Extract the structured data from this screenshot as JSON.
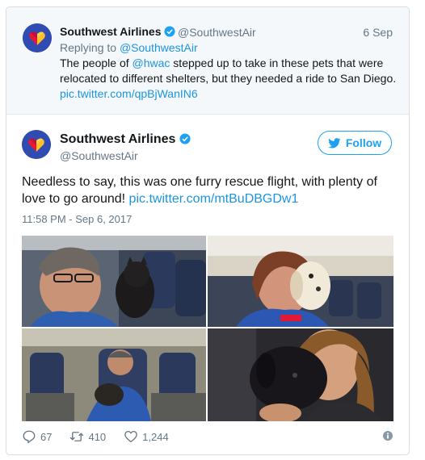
{
  "parent_tweet": {
    "name": "Southwest Airlines",
    "handle": "@SouthwestAir",
    "date": "6 Sep",
    "replying_prefix": "Replying to ",
    "replying_to": "@SouthwestAir",
    "text_1": "The people of ",
    "mention": "@hwac",
    "text_2": " stepped up to take in these pets that were relocated to different shelters, but they needed a ride to San Diego. ",
    "link": "pic.twitter.com/qpBjWanIN6"
  },
  "main_tweet": {
    "name": "Southwest Airlines",
    "handle": "@SouthwestAir",
    "follow_label": "Follow",
    "text": "Needless to say, this was one furry rescue flight, with plenty of love to go around! ",
    "link": "pic.twitter.com/mtBuDBGDw1",
    "timestamp": "11:58 PM - Sep 6, 2017"
  },
  "stats": {
    "replies": "67",
    "retweets": "410",
    "likes": "1,244"
  },
  "icons": {
    "verified": "verified-badge-icon",
    "follow": "twitter-bird-icon",
    "reply": "reply-icon",
    "retweet": "retweet-icon",
    "like": "heart-icon",
    "info": "info-icon"
  },
  "colors": {
    "link": "#1b95e0",
    "accent": "#1da1f2",
    "brand_blue": "#304cb2",
    "brand_red": "#e31837",
    "brand_yellow": "#ffbf27"
  }
}
